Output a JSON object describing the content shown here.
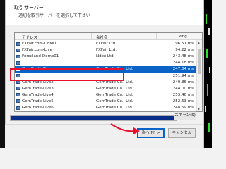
{
  "dialog": {
    "title": "取引サーバー",
    "subtitle": "適切な取引サーバーを選択して下さい"
  },
  "list": {
    "columns": [
      "アドレス",
      "会社名",
      "Ping"
    ],
    "rows": [
      {
        "name": "FXFair.com-DEMO",
        "company": "FXFair Ltd.",
        "ping": "96.51 ms",
        "selected": false
      },
      {
        "name": "FXFair.com-Live",
        "company": "FXFair Ltd.",
        "ping": "94.22 ms",
        "selected": false
      },
      {
        "name": "Forexland-Demo01",
        "company": "Ndex Ltd",
        "ping": "243.48 ms",
        "selected": false
      },
      {
        "name": "",
        "company": "",
        "ping": "244.18 ms",
        "selected": false
      },
      {
        "name": "GemTrade-Demo",
        "company": "GemTrade Co., Ltd.",
        "ping": "247.04 ms",
        "selected": true
      },
      {
        "name": "",
        "company": "",
        "ping": "251.94 ms",
        "selected": false
      },
      {
        "name": "GemTrade-Live2",
        "company": "GemTrade Co., Ltd.",
        "ping": "249.86 ms",
        "selected": false
      },
      {
        "name": "GemTrade-Live3",
        "company": "GemTrade Co., Ltd.",
        "ping": "244.00 ms",
        "selected": false
      },
      {
        "name": "GemTrade-Live4",
        "company": "GemTrade Co., Ltd.",
        "ping": "253.46 ms",
        "selected": false
      },
      {
        "name": "GemTrade-Live5",
        "company": "GemTrade Co., Ltd.",
        "ping": "252.63 ms",
        "selected": false
      },
      {
        "name": "GemTrade-Live6",
        "company": "GemTrade Co., Ltd.",
        "ping": "248.69 ms",
        "selected": false
      }
    ]
  },
  "progress": {
    "fraction": 0.99
  },
  "buttons": {
    "scan": "スキャン(S)",
    "next": "次へ(N) >",
    "cancel": "キャンセル"
  },
  "colors": {
    "selection": "#0b63c6",
    "highlight": "#e8112d",
    "progress_fill": "#0b2d8a"
  }
}
